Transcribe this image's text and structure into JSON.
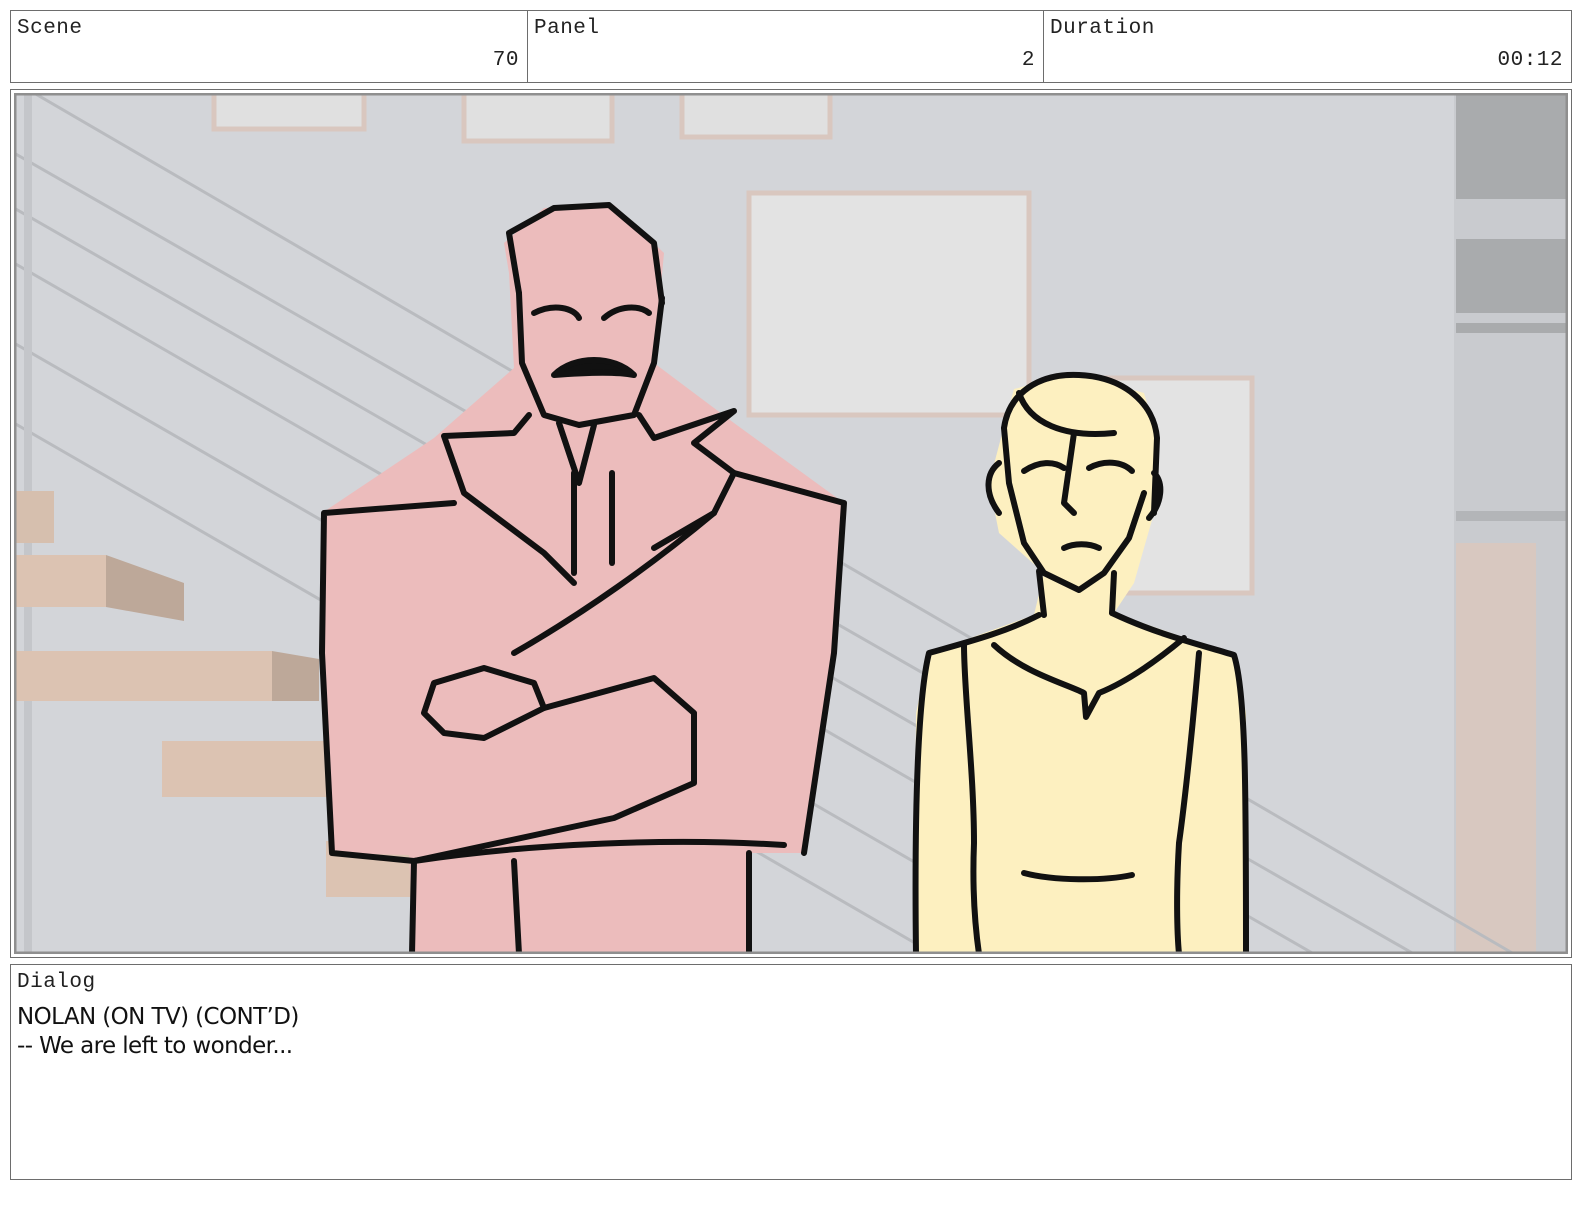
{
  "header": {
    "scene": {
      "label": "Scene",
      "value": "70"
    },
    "panel": {
      "label": "Panel",
      "value": "2"
    },
    "duration": {
      "label": "Duration",
      "value": "00:12"
    }
  },
  "dialog": {
    "label": "Dialog",
    "lines": [
      "NOLAN (ON TV) (CONT’D)",
      "-- We are left to wonder..."
    ]
  },
  "colors": {
    "border": "#6d6d6d",
    "wall": "#d3d5d9",
    "man_fill": "#ecbcbc",
    "woman_fill": "#fdf0c0",
    "stairs": "#d8bfae",
    "ink": "#111111"
  }
}
